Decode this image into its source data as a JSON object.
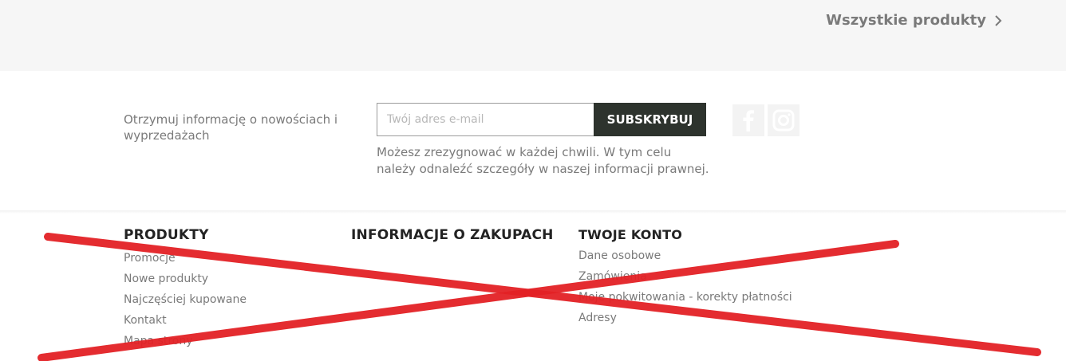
{
  "header": {
    "all_products_label": "Wszystkie produkty"
  },
  "newsletter": {
    "text": "Otrzymuj informację o nowościach i wyprzedażach",
    "email_placeholder": "Twój adres e-mail",
    "subscribe_label": "SUBSKRYBUJ",
    "conditions": "Możesz zrezygnować w każdej chwili. W tym celu należy odnaleźć szczegóły w naszej informacji prawnej."
  },
  "social": {
    "icons": [
      "facebook-icon",
      "instagram-icon"
    ]
  },
  "footer": {
    "products": {
      "title": "PRODUKTY",
      "links": [
        "Promocje",
        "Nowe produkty",
        "Najczęściej kupowane",
        "Kontakt",
        "Mapa strony"
      ]
    },
    "purchase_info": {
      "title": "INFORMACJE O ZAKUPACH"
    },
    "account": {
      "title": "TWOJE KONTO",
      "links": [
        "Dane osobowe",
        "Zamówienia",
        "Moje pokwitowania - korekty płatności",
        "Adresy"
      ]
    }
  },
  "colors": {
    "subscribe_bg": "#2d332d",
    "cross_stroke": "#e32125",
    "top_band_bg": "#f6f6f6"
  }
}
